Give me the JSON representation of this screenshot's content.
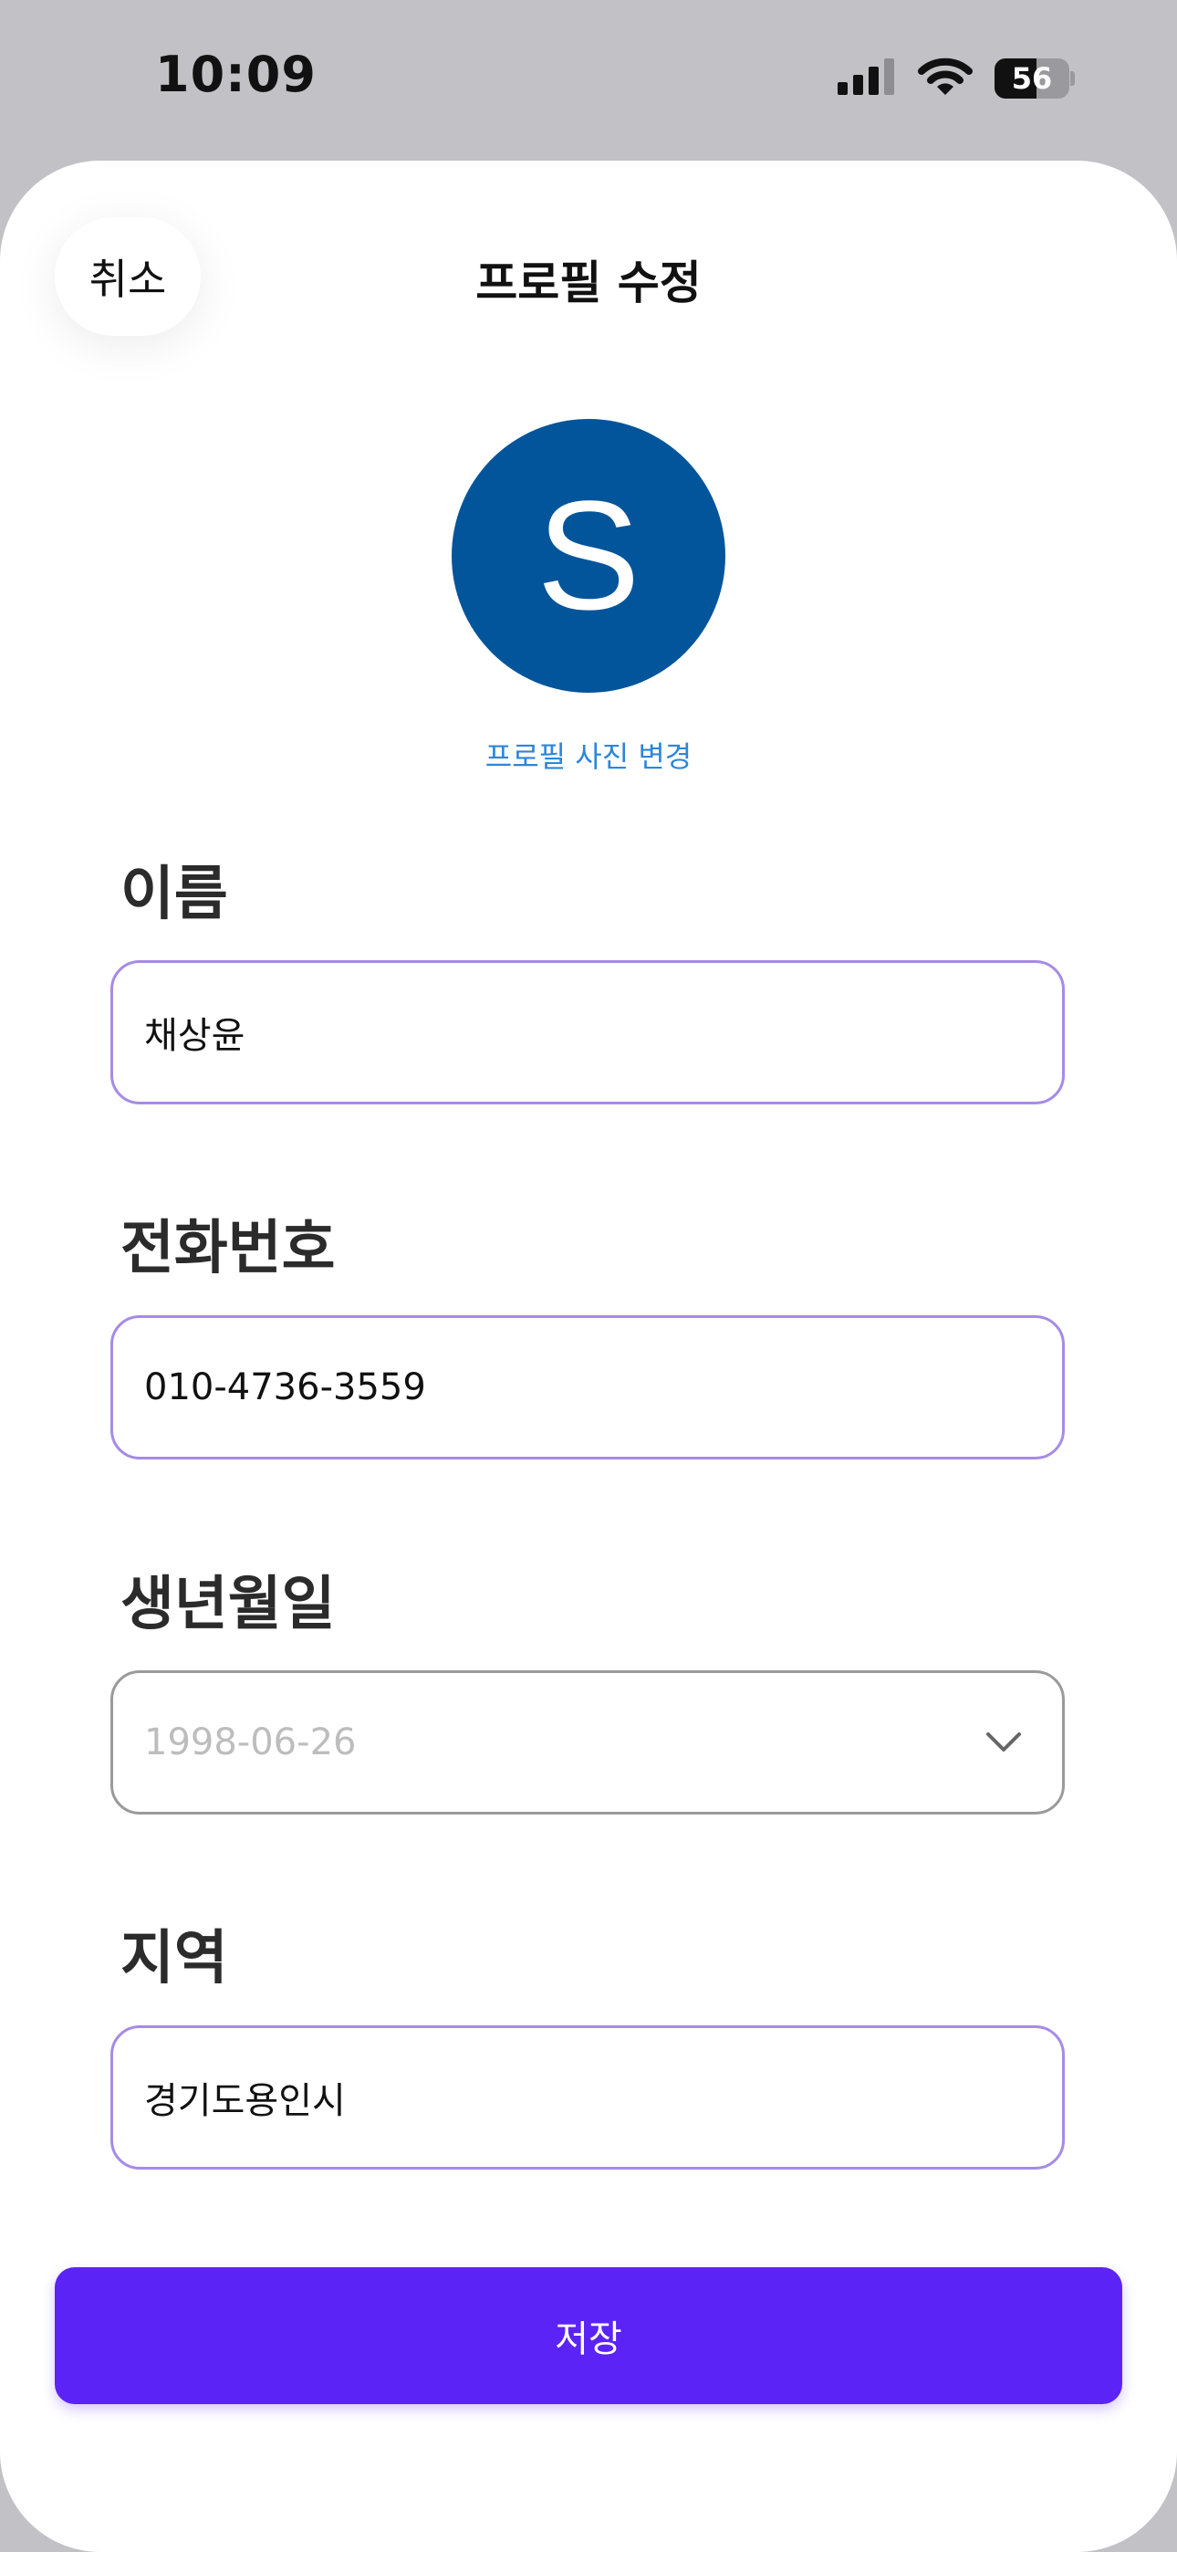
{
  "status_bar": {
    "time": "10:09",
    "battery_level": "56",
    "icons": [
      "cellular-signal-icon",
      "wifi-icon",
      "battery-icon"
    ]
  },
  "header": {
    "cancel_label": "취소",
    "title": "프로필 수정"
  },
  "profile": {
    "avatar_initial": "S",
    "avatar_color": "#02559a",
    "change_photo_label": "프로필 사진 변경"
  },
  "form": {
    "name": {
      "label": "이름",
      "value": "채상윤"
    },
    "phone": {
      "label": "전화번호",
      "value": "010-4736-3559"
    },
    "birthdate": {
      "label": "생년월일",
      "value": "1998-06-26"
    },
    "region": {
      "label": "지역",
      "value": "경기도용인시"
    }
  },
  "save_label": "저장",
  "colors": {
    "accent": "#5b23f5",
    "input_border": "#a68be6",
    "link": "#2d86d9"
  }
}
